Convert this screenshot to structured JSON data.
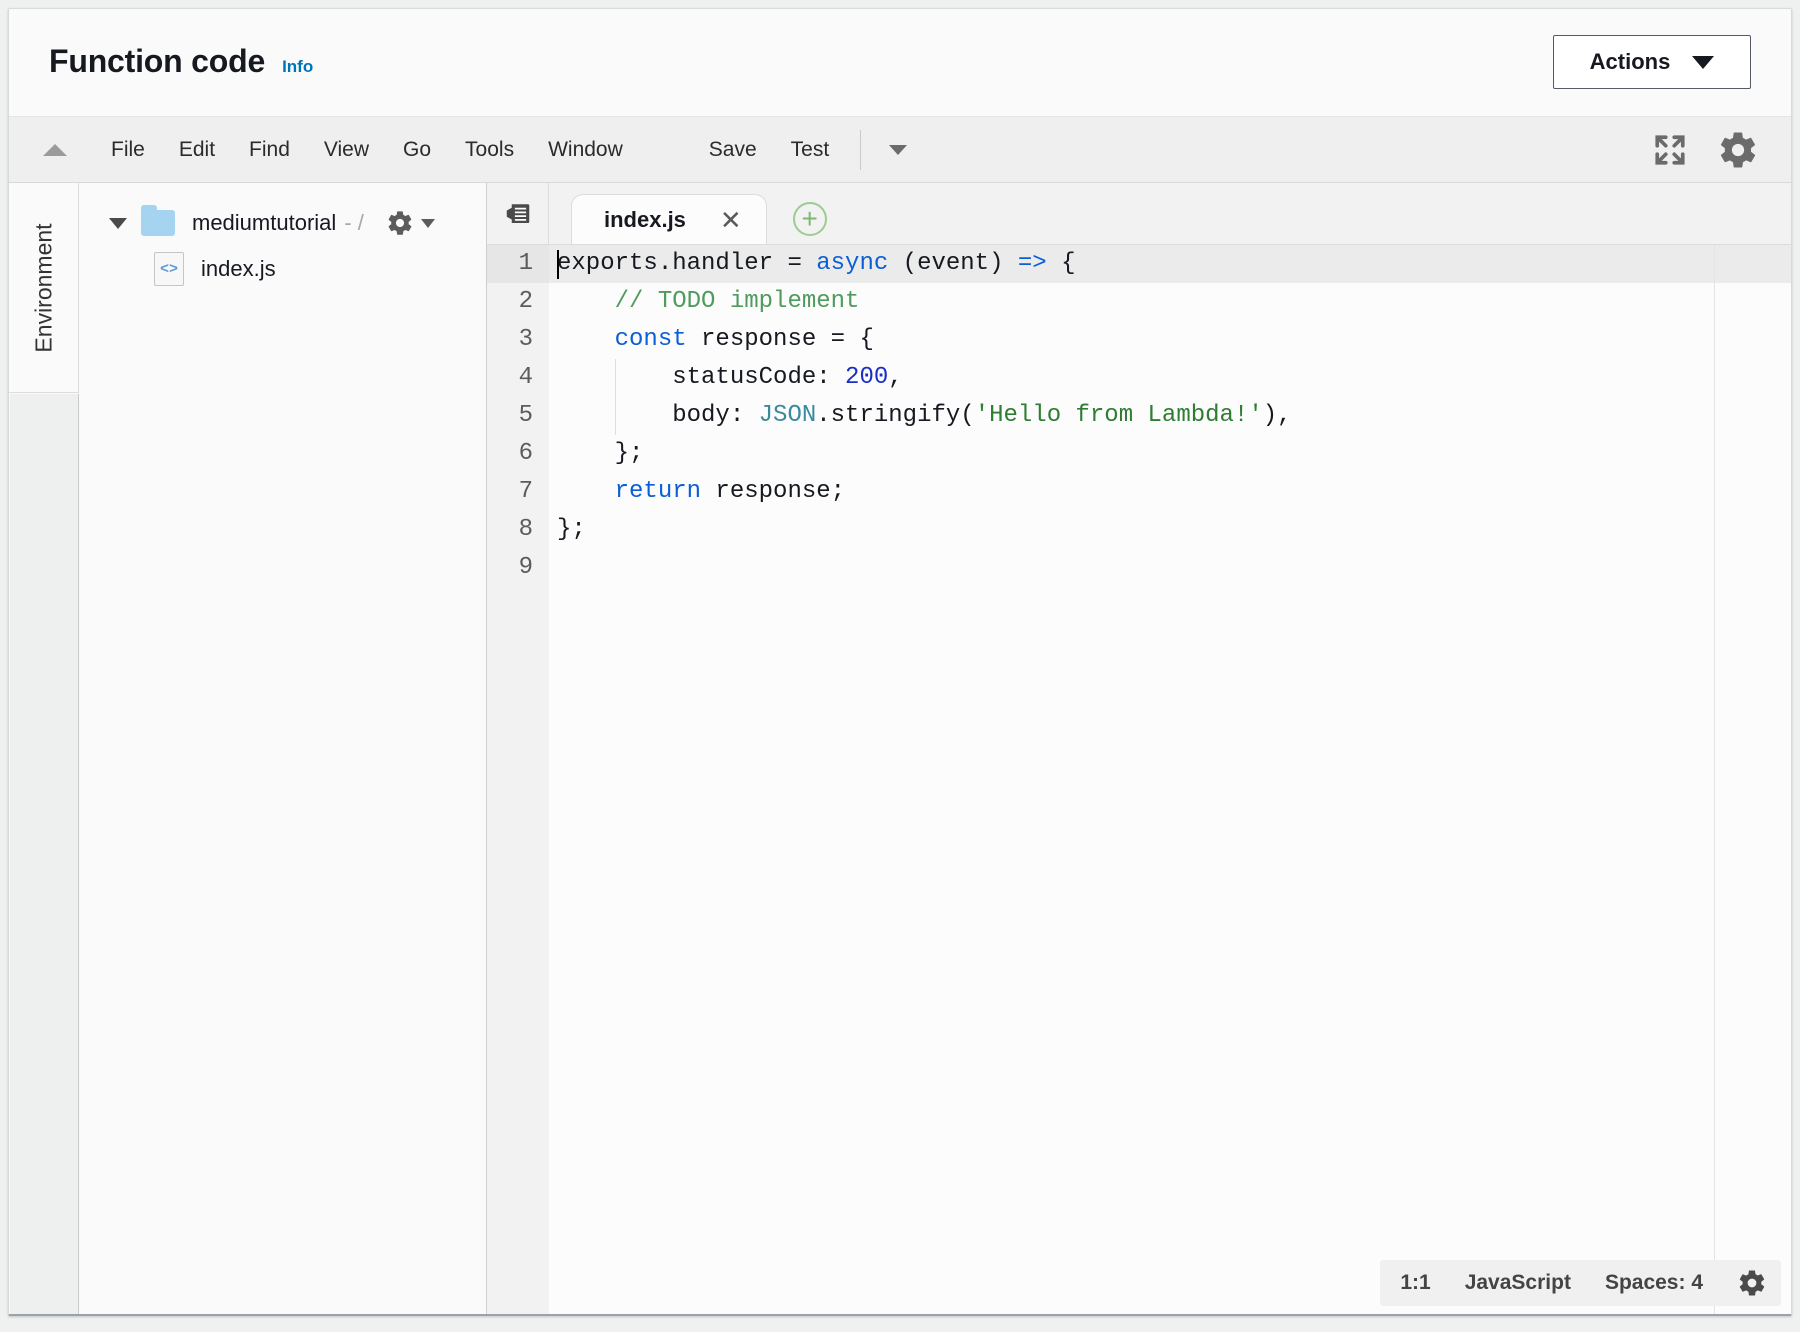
{
  "header": {
    "title": "Function code",
    "info_label": "Info",
    "actions_label": "Actions"
  },
  "menubar": {
    "items": [
      "File",
      "Edit",
      "Find",
      "View",
      "Go",
      "Tools",
      "Window"
    ],
    "save_label": "Save",
    "test_label": "Test",
    "icons": {
      "collapse": "triangle-up-icon",
      "fullscreen": "fullscreen-icon",
      "settings": "gear-icon",
      "test_dropdown": "chevron-down-icon"
    }
  },
  "sidebar": {
    "env_label": "Environment",
    "folder": {
      "name": "mediumtutorial",
      "dim_suffix": "- /",
      "gear_icon": "gear-icon",
      "expanded_icon": "triangle-down-icon"
    },
    "files": [
      {
        "name": "index.js",
        "icon": "js-file-icon"
      }
    ]
  },
  "editor": {
    "outline_icon": "outline-list-icon",
    "new_tab_icon": "plus-circle-icon",
    "tabs": [
      {
        "label": "index.js",
        "active": true,
        "close_icon": "close-icon"
      }
    ],
    "line_numbers": [
      "1",
      "2",
      "3",
      "4",
      "5",
      "6",
      "7",
      "8",
      "9"
    ],
    "active_line": 1,
    "code_lines": [
      [
        {
          "t": "exports.handler ",
          "c": "txt"
        },
        {
          "t": "= ",
          "c": "txt"
        },
        {
          "t": "async",
          "c": "kw"
        },
        {
          "t": " (event) ",
          "c": "txt"
        },
        {
          "t": "=>",
          "c": "arrow"
        },
        {
          "t": " {",
          "c": "txt"
        }
      ],
      [
        {
          "t": "    ",
          "c": "txt"
        },
        {
          "t": "// TODO implement",
          "c": "cmt"
        }
      ],
      [
        {
          "t": "    ",
          "c": "txt"
        },
        {
          "t": "const",
          "c": "kw"
        },
        {
          "t": " response = {",
          "c": "txt"
        }
      ],
      [
        {
          "t": "        statusCode: ",
          "c": "txt"
        },
        {
          "t": "200",
          "c": "num"
        },
        {
          "t": ",",
          "c": "txt"
        }
      ],
      [
        {
          "t": "        body: ",
          "c": "txt"
        },
        {
          "t": "JSON",
          "c": "cls"
        },
        {
          "t": ".stringify(",
          "c": "txt"
        },
        {
          "t": "'Hello from Lambda!'",
          "c": "str"
        },
        {
          "t": "),",
          "c": "txt"
        }
      ],
      [
        {
          "t": "    };",
          "c": "txt"
        }
      ],
      [
        {
          "t": "    ",
          "c": "txt"
        },
        {
          "t": "return",
          "c": "kw"
        },
        {
          "t": " response;",
          "c": "txt"
        }
      ],
      [
        {
          "t": "};",
          "c": "txt"
        }
      ],
      []
    ]
  },
  "statusbar": {
    "cursor_position": "1:1",
    "language": "JavaScript",
    "indentation": "Spaces: 4",
    "gear_icon": "gear-icon"
  },
  "colors": {
    "link": "#0073bb",
    "keyword": "#0b5fd6",
    "comment": "#4f9b5e",
    "string": "#2e7d32",
    "number": "#1b2fc4",
    "class": "#3a8a9e",
    "folder": "#a5d4f0",
    "new_tab": "#9ccc8f"
  }
}
